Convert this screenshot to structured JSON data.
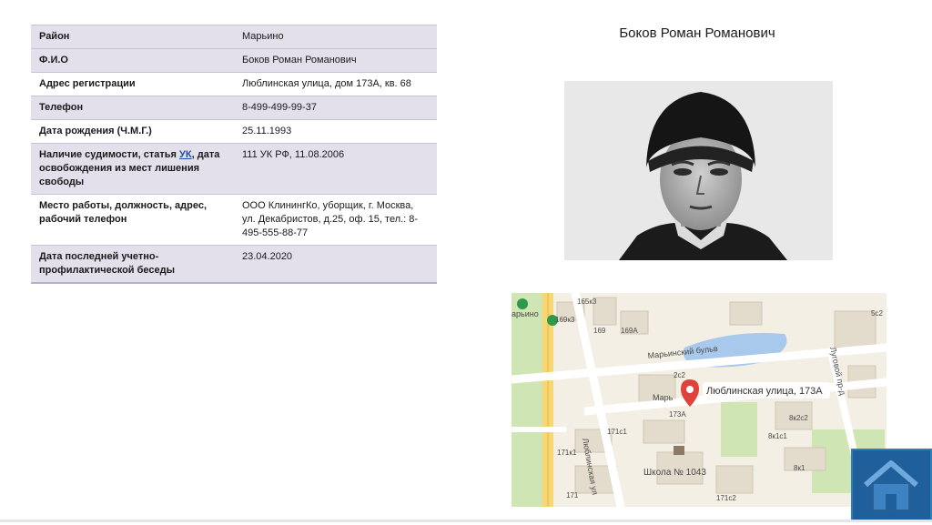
{
  "header": {
    "person_name": "Боков Роман Романович"
  },
  "table": {
    "rows": [
      {
        "label": "Район",
        "value": "Марьино"
      },
      {
        "label": "Ф.И.О",
        "value": "Боков Роман Романович"
      },
      {
        "label": "Адрес регистрации",
        "value": "Люблинская улица, дом 173А, кв. 68"
      },
      {
        "label": "Телефон",
        "value": "8-499-499-99-37"
      },
      {
        "label": "Дата рождения (Ч.М.Г.)",
        "value": "25.11.1993"
      },
      {
        "label_before": "Наличие судимости, статья ",
        "label_link": "УК",
        "label_after": ", дата освобождения из мест лишения свободы",
        "value": "111 УК РФ, 11.08.2006"
      },
      {
        "label": "Место работы, должность, адрес, рабочий телефон",
        "value": "ООО КлинингКо, уборщик, г. Москва, ул. Декабристов, д.25, оф. 15, тел.: 8-495-555-88-77"
      },
      {
        "label": "Дата последней учетно-профилактической беседы",
        "value": "23.04.2020"
      }
    ]
  },
  "map": {
    "pin_label": "Люблинская улица, 173А",
    "labels": {
      "marino": "арьино",
      "k165": "165к3",
      "k169_3": "169к3",
      "k169": "169",
      "k169a": "169А",
      "k169a_b": "169А",
      "marinsky": "Марьинский бульв",
      "street_mar": "Марь",
      "k2c2": "2с2",
      "k173a": "173А",
      "k171c1": "171с1",
      "k171k1": "171к1",
      "k171c2": "171с2",
      "school": "Школа № 1043",
      "k8k1c1": "8к1с1",
      "k8k2c2": "8к2с2",
      "k8k2c1": "8к2с1",
      "k8k1": "8к1",
      "k5c2": "5с2",
      "k5c1": "5с1",
      "k4c2": "4с2",
      "k171": "171",
      "lublinskaya_road": "Люблинская ул",
      "lugovoy": "Луговой пр-д",
      "blv": "ьв"
    },
    "colors": {
      "road_main": "#f7d774",
      "road_edge": "#e2b84a",
      "park": "#cfe5b3",
      "water": "#a9c9ec",
      "pin": "#e0413a"
    }
  },
  "nav": {
    "home_icon": "home-icon"
  }
}
